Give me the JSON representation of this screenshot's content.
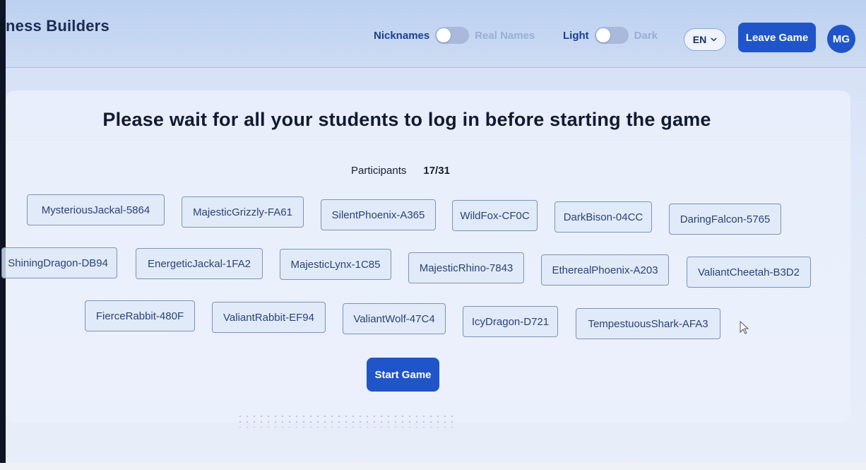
{
  "header": {
    "brand": "ness Builders",
    "names_toggle": {
      "left_label": "Nicknames",
      "right_label": "Real Names"
    },
    "theme_toggle": {
      "left_label": "Light",
      "right_label": "Dark"
    },
    "language": "EN",
    "leave_button": "Leave Game",
    "avatar_initials": "MG"
  },
  "main": {
    "title": "Please wait for all your students to log in before starting the game",
    "participants_label": "Participants",
    "participants_count": "17/31",
    "students": [
      "MysteriousJackal-5864",
      "MajesticGrizzly-FA61",
      "SilentPhoenix-A365",
      "WildFox-CF0C",
      "DarkBison-04CC",
      "DaringFalcon-5765",
      "ShiningDragon-DB94",
      "EnergeticJackal-1FA2",
      "MajesticLynx-1C85",
      "MajesticRhino-7843",
      "EtherealPhoenix-A203",
      "ValiantCheetah-B3D2",
      "FierceRabbit-480F",
      "ValiantRabbit-EF94",
      "ValiantWolf-47C4",
      "IcyDragon-D721",
      "TempestuousShark-AFA3"
    ],
    "start_button": "Start Game"
  },
  "colors": {
    "primary": "#1f55c8",
    "title": "#121a33",
    "chip_text": "#2a4278"
  }
}
